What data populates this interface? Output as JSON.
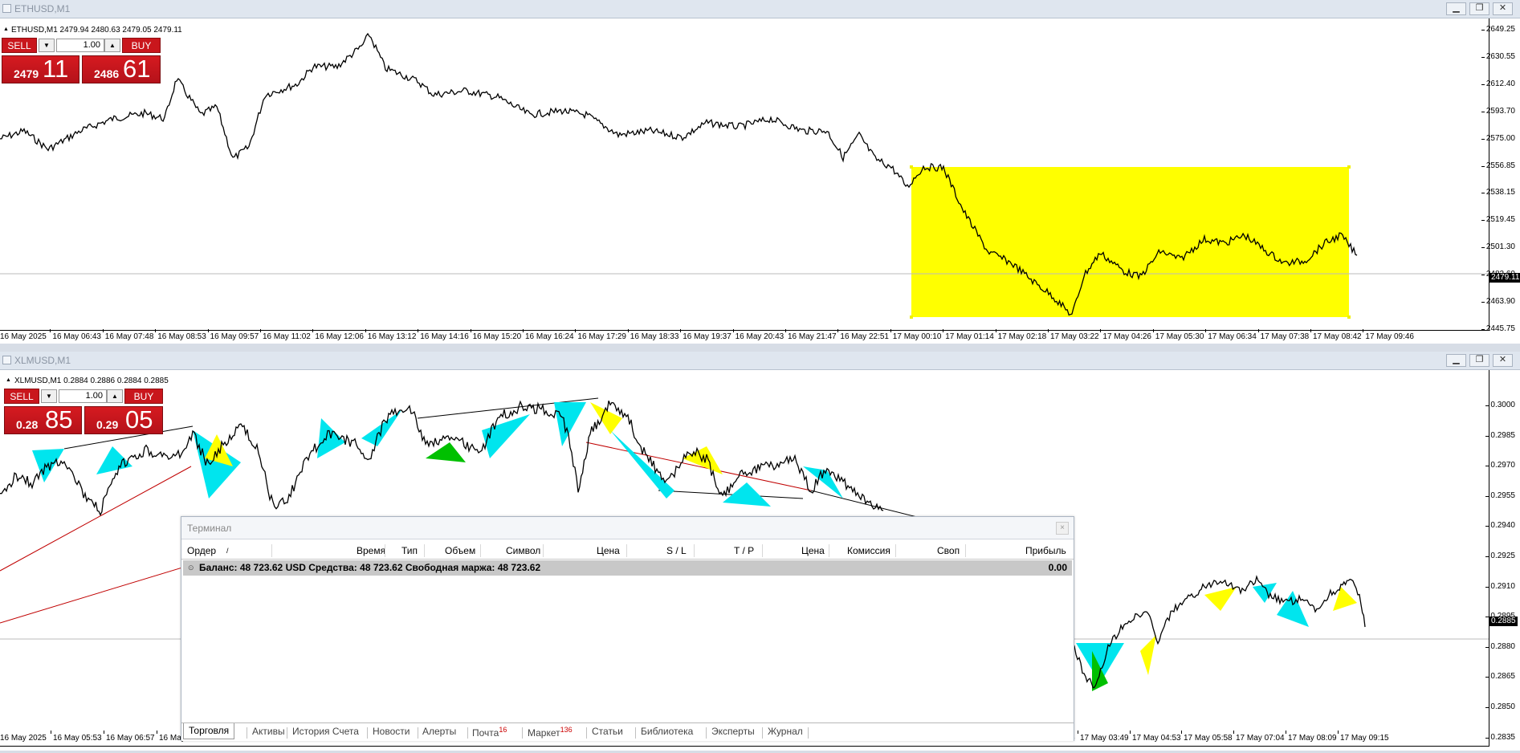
{
  "colors": {
    "sell": "#c9161c",
    "highlight": "#ffff00",
    "zigzag_cyan": "#00e5ee",
    "zigzag_green": "#00c000",
    "trendline_red": "#c00000"
  },
  "window1": {
    "title": "ETHUSD,M1",
    "symbol_line": "ETHUSD,M1  2479.94 2480.63 2479.05 2479.11",
    "trade": {
      "sell_label": "SELL",
      "buy_label": "BUY",
      "lot": "1.00",
      "sell_small": "2479",
      "sell_big": "11",
      "buy_small": "2486",
      "buy_big": "61"
    },
    "prices": [
      "2649.25",
      "2630.55",
      "2612.40",
      "2593.70",
      "2575.00",
      "2556.85",
      "2538.15",
      "2519.45",
      "2501.30",
      "2482.60",
      "2463.90",
      "2445.75"
    ],
    "current_price": "2479.11",
    "times": [
      "16 May 2025",
      "16 May 06:43",
      "16 May 07:48",
      "16 May 08:53",
      "16 May 09:57",
      "16 May 11:02",
      "16 May 12:06",
      "16 May 13:12",
      "16 May 14:16",
      "16 May 15:20",
      "16 May 16:24",
      "16 May 17:29",
      "16 May 18:33",
      "16 May 19:37",
      "16 May 20:43",
      "16 May 21:47",
      "16 May 22:51",
      "17 May 00:10",
      "17 May 01:14",
      "17 May 02:18",
      "17 May 03:22",
      "17 May 04:26",
      "17 May 05:30",
      "17 May 06:34",
      "17 May 07:38",
      "17 May 08:42",
      "17 May 09:46"
    ]
  },
  "window2": {
    "title": "XLMUSD,M1",
    "symbol_line": "XLMUSD,M1  0.2884 0.2886 0.2884 0.2885",
    "trade": {
      "sell_label": "SELL",
      "buy_label": "BUY",
      "lot": "1.00",
      "sell_small": "0.28",
      "sell_big": "85",
      "buy_small": "0.29",
      "buy_big": "05"
    },
    "prices": [
      "0.3000",
      "0.2985",
      "0.2970",
      "0.2955",
      "0.2940",
      "0.2925",
      "0.2910",
      "0.2895",
      "0.2880",
      "0.2865",
      "0.2850",
      "0.2835"
    ],
    "current_price": "0.2885",
    "times_left": [
      "16 May 2025",
      "16 May 05:53",
      "16 May 06:57",
      "16 May"
    ],
    "times_right": [
      "5",
      "17 May 03:49",
      "17 May 04:53",
      "17 May 05:58",
      "17 May 07:04",
      "17 May 08:09",
      "17 May 09:15"
    ]
  },
  "terminal": {
    "title": "Терминал",
    "close": "×",
    "columns": [
      {
        "label": "Ордер",
        "sort": "/"
      },
      {
        "label": "Время"
      },
      {
        "label": "Тип"
      },
      {
        "label": "Объем"
      },
      {
        "label": "Символ"
      },
      {
        "label": "Цена"
      },
      {
        "label": "S / L"
      },
      {
        "label": "T / P"
      },
      {
        "label": "Цена"
      },
      {
        "label": "Комиссия"
      },
      {
        "label": "Своп"
      },
      {
        "label": "Прибыль"
      }
    ],
    "balance_line": "Баланс: 48 723.62 USD  Средства: 48 723.62  Свободная маржа: 48 723.62",
    "balance_profit": "0.00",
    "tabs": [
      {
        "label": "Торговля",
        "active": true
      },
      {
        "label": "Активы"
      },
      {
        "label": "История Счета"
      },
      {
        "label": "Новости"
      },
      {
        "label": "Алерты"
      },
      {
        "label": "Почта",
        "badge": "16"
      },
      {
        "label": "Маркет",
        "badge": "136"
      },
      {
        "label": "Статьи"
      },
      {
        "label": "Библиотека"
      },
      {
        "label": "Эксперты"
      },
      {
        "label": "Журнал"
      }
    ]
  }
}
